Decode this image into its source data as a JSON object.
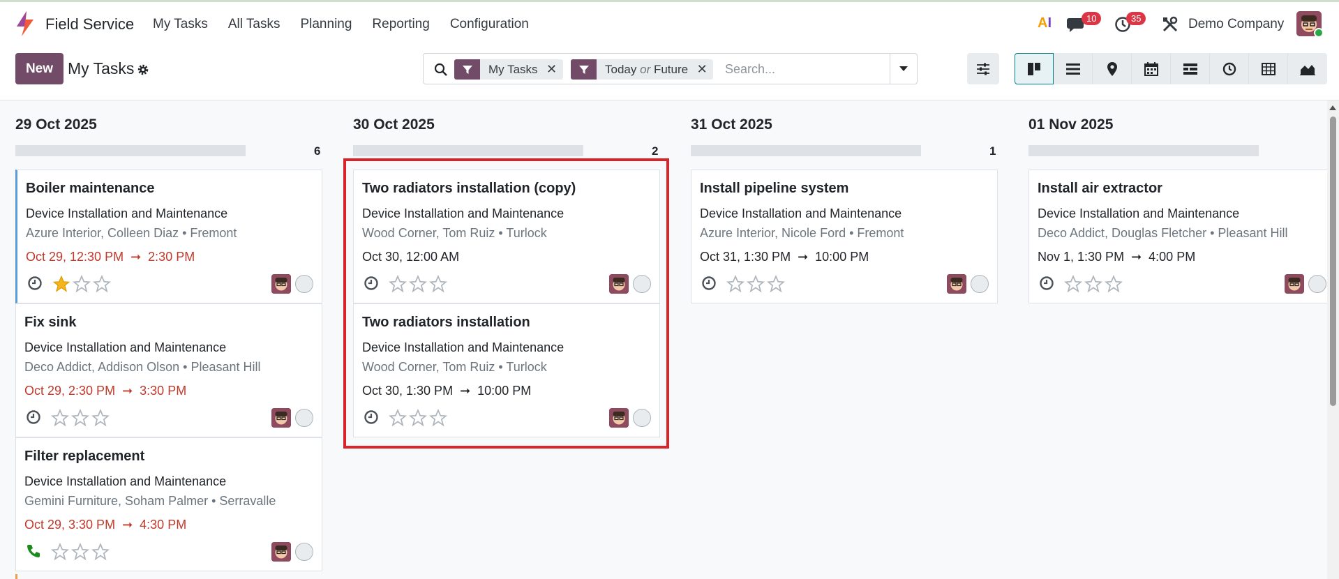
{
  "app": {
    "name": "Field Service",
    "menu": [
      "My Tasks",
      "All Tasks",
      "Planning",
      "Reporting",
      "Configuration"
    ]
  },
  "systray": {
    "ai_label_a": "A",
    "ai_label_i": "I",
    "messages_count": "10",
    "activities_count": "35",
    "company": "Demo Company"
  },
  "control_panel": {
    "new_label": "New",
    "title": "My Tasks",
    "facets": [
      {
        "label": "My Tasks"
      },
      {
        "label_a": "Today",
        "or": "or",
        "label_b": "Future"
      }
    ],
    "search_placeholder": "Search..."
  },
  "colors": {
    "brand": "#714b67",
    "overdue": "#c0392b",
    "highlight": "#d9252a",
    "badge": "#dc3545",
    "star_on": "#f3b51b"
  },
  "columns": [
    {
      "title": "29 Oct 2025",
      "count": "6",
      "cards": [
        {
          "title": "Boiler maintenance",
          "project": "Device Installation and Maintenance",
          "partner": "Azure Interior, Colleen Diaz • Fremont",
          "start": "Oct 29, 12:30 PM",
          "end": "2:30 PM",
          "overdue": true,
          "stars": 1,
          "icon": "clock-icon"
        },
        {
          "title": "Fix sink",
          "project": "Device Installation and Maintenance",
          "partner": "Deco Addict, Addison Olson • Pleasant Hill",
          "start": "Oct 29, 2:30 PM",
          "end": "3:30 PM",
          "overdue": true,
          "stars": 0,
          "icon": "clock-icon"
        },
        {
          "title": "Filter replacement",
          "project": "Device Installation and Maintenance",
          "partner": "Gemini Furniture, Soham Palmer • Serravalle",
          "start": "Oct 29, 3:30 PM",
          "end": "4:30 PM",
          "overdue": true,
          "stars": 0,
          "icon": "phone-icon"
        }
      ]
    },
    {
      "title": "30 Oct 2025",
      "count": "2",
      "cards": [
        {
          "title": "Two radiators installation (copy)",
          "project": "Device Installation and Maintenance",
          "partner": "Wood Corner, Tom Ruiz • Turlock",
          "start": "Oct 30, 12:00 AM",
          "end": "",
          "overdue": false,
          "stars": 0,
          "icon": "clock-icon"
        },
        {
          "title": "Two radiators installation",
          "project": "Device Installation and Maintenance",
          "partner": "Wood Corner, Tom Ruiz • Turlock",
          "start": "Oct 30, 1:30 PM",
          "end": "10:00 PM",
          "overdue": false,
          "stars": 0,
          "icon": "clock-icon"
        }
      ]
    },
    {
      "title": "31 Oct 2025",
      "count": "1",
      "cards": [
        {
          "title": "Install pipeline system",
          "project": "Device Installation and Maintenance",
          "partner": "Azure Interior, Nicole Ford • Fremont",
          "start": "Oct 31, 1:30 PM",
          "end": "10:00 PM",
          "overdue": false,
          "stars": 0,
          "icon": "clock-icon"
        }
      ]
    },
    {
      "title": "01 Nov 2025",
      "count": "",
      "cards": [
        {
          "title": "Install air extractor",
          "project": "Device Installation and Maintenance",
          "partner": "Deco Addict, Douglas Fletcher • Pleasant Hill",
          "start": "Nov 1, 1:30 PM",
          "end": "4:00 PM",
          "overdue": false,
          "stars": 0,
          "icon": "clock-icon"
        }
      ]
    }
  ]
}
